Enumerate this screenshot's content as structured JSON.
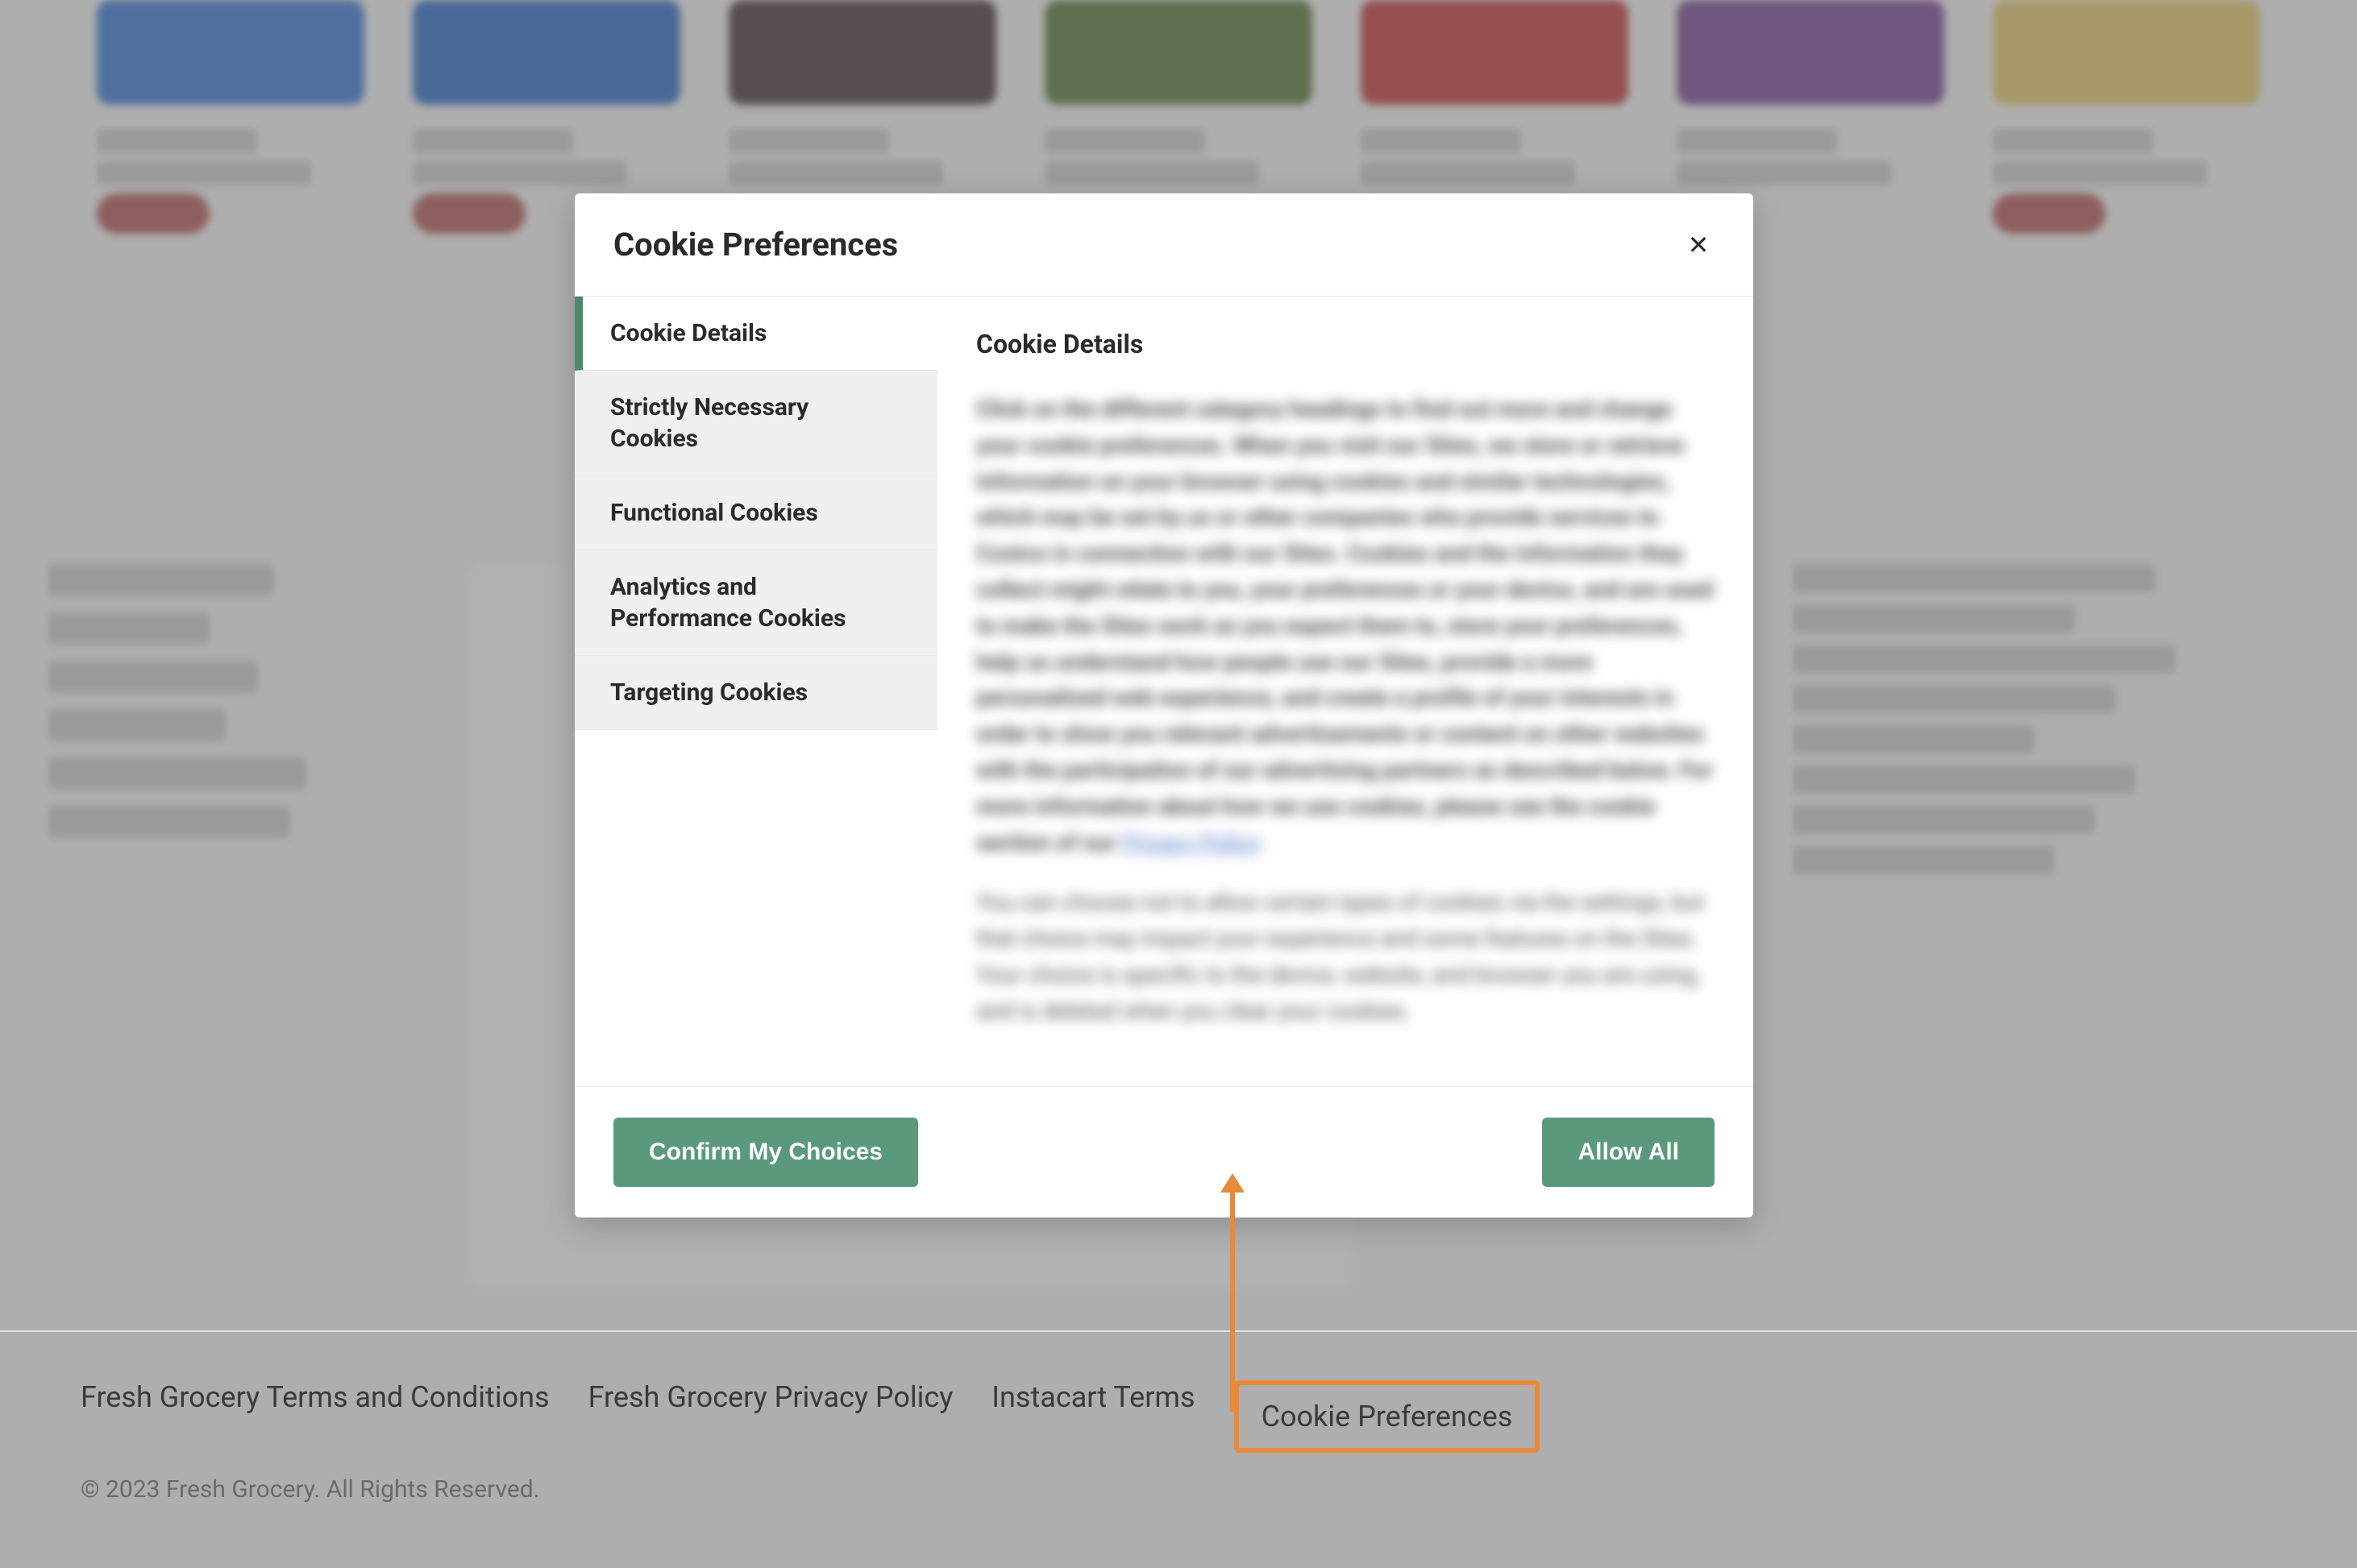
{
  "modal": {
    "title": "Cookie Preferences",
    "content_heading": "Cookie Details",
    "tabs": {
      "cookie_details": "Cookie Details",
      "strictly_necessary": "Strictly Necessary Cookies",
      "functional": "Functional Cookies",
      "analytics": "Analytics and Performance Cookies",
      "targeting": "Targeting Cookies"
    },
    "body_text_1": "Click on the different category headings to find out more and change your cookie preferences. When you visit our Sites, we store or retrieve information on your browser using cookies and similar technologies, which may be set by us or other companies who provide services to Costco in connection with our Sites. Cookies and the information they collect might relate to you, your preferences or your device, and are used to make the Sites work as you expect them to, store your preferences, help us understand how people use our Sites, provide a more personalized web experience, and create a profile of your interests in order to show you relevant advertisements or content on other websites with the participation of our advertising partners as described below. For more information about how we use cookies, please see the cookie section of our",
    "privacy_link": "Privacy Policy",
    "body_text_2": "You can choose not to allow certain types of cookies via the settings, but that choice may impact your experience and some features on the Sites. Your choice is specific to the device, website, and browser you are using, and is deleted when you clear your cookies.",
    "confirm_button": "Confirm My Choices",
    "allow_button": "Allow All"
  },
  "footer": {
    "links": {
      "terms": "Fresh Grocery Terms and Conditions",
      "privacy": "Fresh Grocery Privacy Policy",
      "instacart": "Instacart Terms",
      "cookies": "Cookie Preferences"
    },
    "copyright": "© 2023 Fresh Grocery. All Rights Reserved."
  }
}
